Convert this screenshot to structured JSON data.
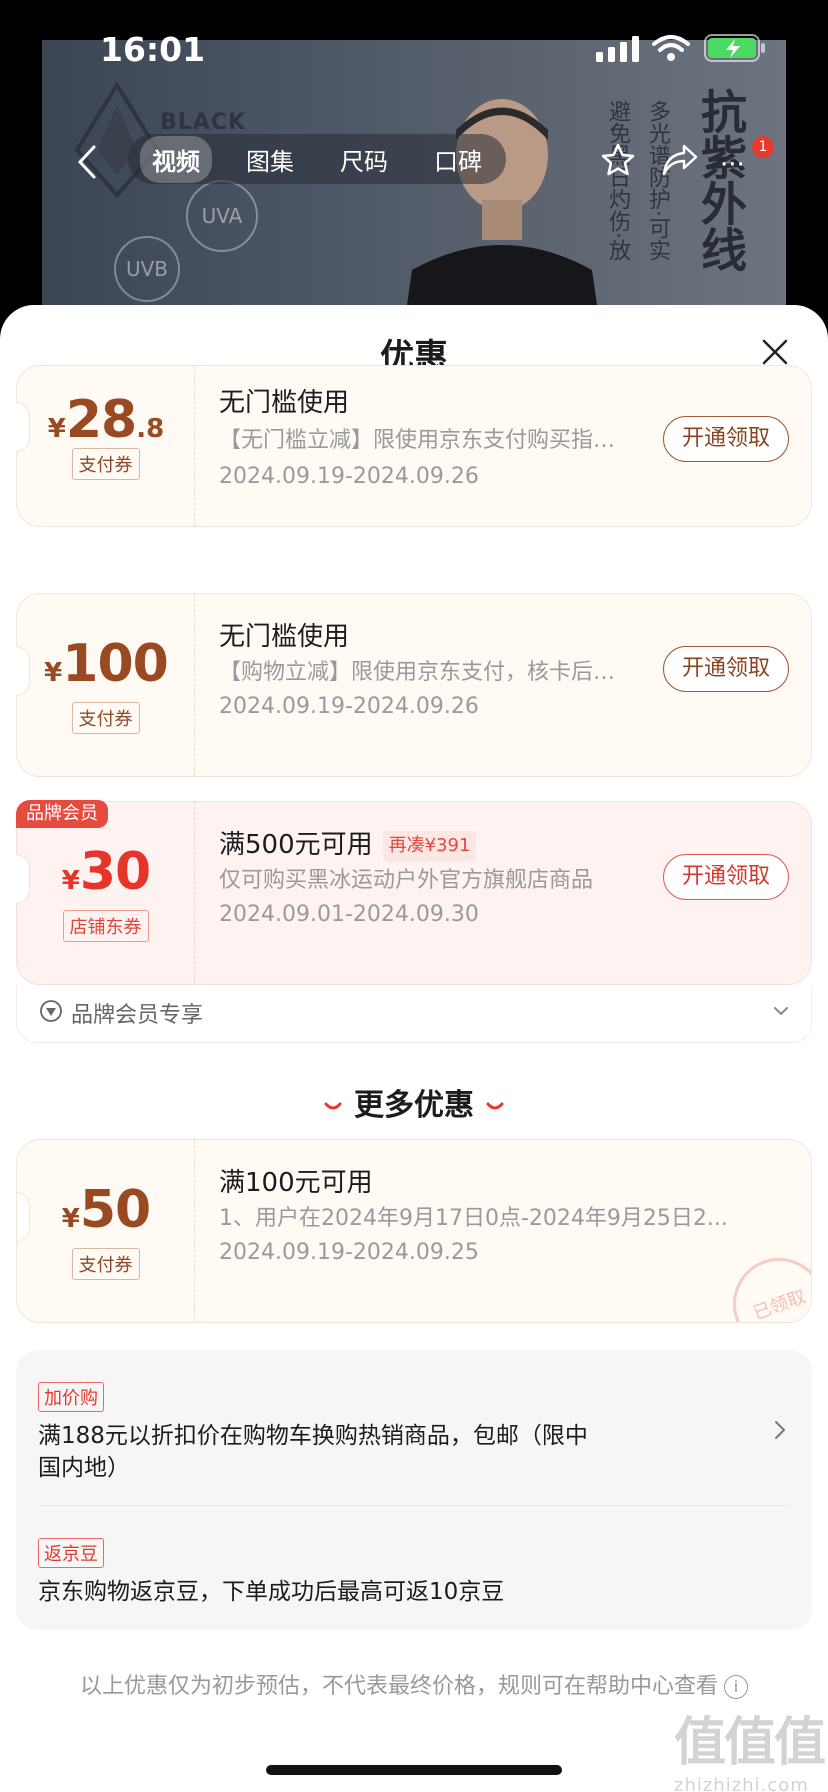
{
  "status": {
    "time": "16:01"
  },
  "product_tabs": [
    "视频",
    "图集",
    "尺码",
    "口碑"
  ],
  "hero": {
    "brand": "BLACK",
    "bubbles": [
      "UVA",
      "UVB"
    ],
    "vertical_text_a": "避免黑日灼伤·放",
    "vertical_text_b": "多光谱防护·可实",
    "big_text": "抗紫外线",
    "cart_badge": "1"
  },
  "sheet": {
    "title": "优惠"
  },
  "coupons": [
    {
      "currency": "¥",
      "amount": "28",
      "decimal": ".8",
      "tag": "支付券",
      "title": "无门槛使用",
      "desc": "【无门槛立减】限使用京东支付购买指定商品",
      "date": "2024.09.19-2024.09.26",
      "button": "开通领取"
    },
    {
      "currency": "¥",
      "amount": "100",
      "decimal": "",
      "tag": "支付券",
      "title": "无门槛使用",
      "desc": "【购物立减】限使用京东支付，核卡后可用",
      "date": "2024.09.19-2024.09.26",
      "button": "开通领取"
    },
    {
      "currency": "¥",
      "amount": "30",
      "decimal": "",
      "tag": "店铺东券",
      "flag": "品牌会员",
      "title": "满500元可用",
      "extra_tag": "再凑¥391",
      "desc": "仅可购买黑冰运动户外官方旗舰店商品",
      "date": "2024.09.01-2024.09.30",
      "button": "开通领取"
    }
  ],
  "member_bar": {
    "text": "品牌会员专享"
  },
  "more": {
    "heading": "更多优惠",
    "coupon": {
      "currency": "¥",
      "amount": "50",
      "tag": "支付券",
      "title": "满100元可用",
      "desc": "1、用户在2024年9月17日0点-2024年9月25日2...",
      "date": "2024.09.19-2024.09.25",
      "stamp": "已领取"
    }
  },
  "promos": [
    {
      "tag": "加价购",
      "text": "满188元以折扣价在购物车换购热销商品，包邮（限中国内地）"
    },
    {
      "tag": "返京豆",
      "text": "京东购物返京豆，下单成功后最高可返10京豆"
    }
  ],
  "footnote": "以上优惠仅为初步预估，不代表最终价格，规则可在帮助中心查看",
  "watermark": {
    "big": "值值值",
    "small": "zhizhizhi.com"
  }
}
